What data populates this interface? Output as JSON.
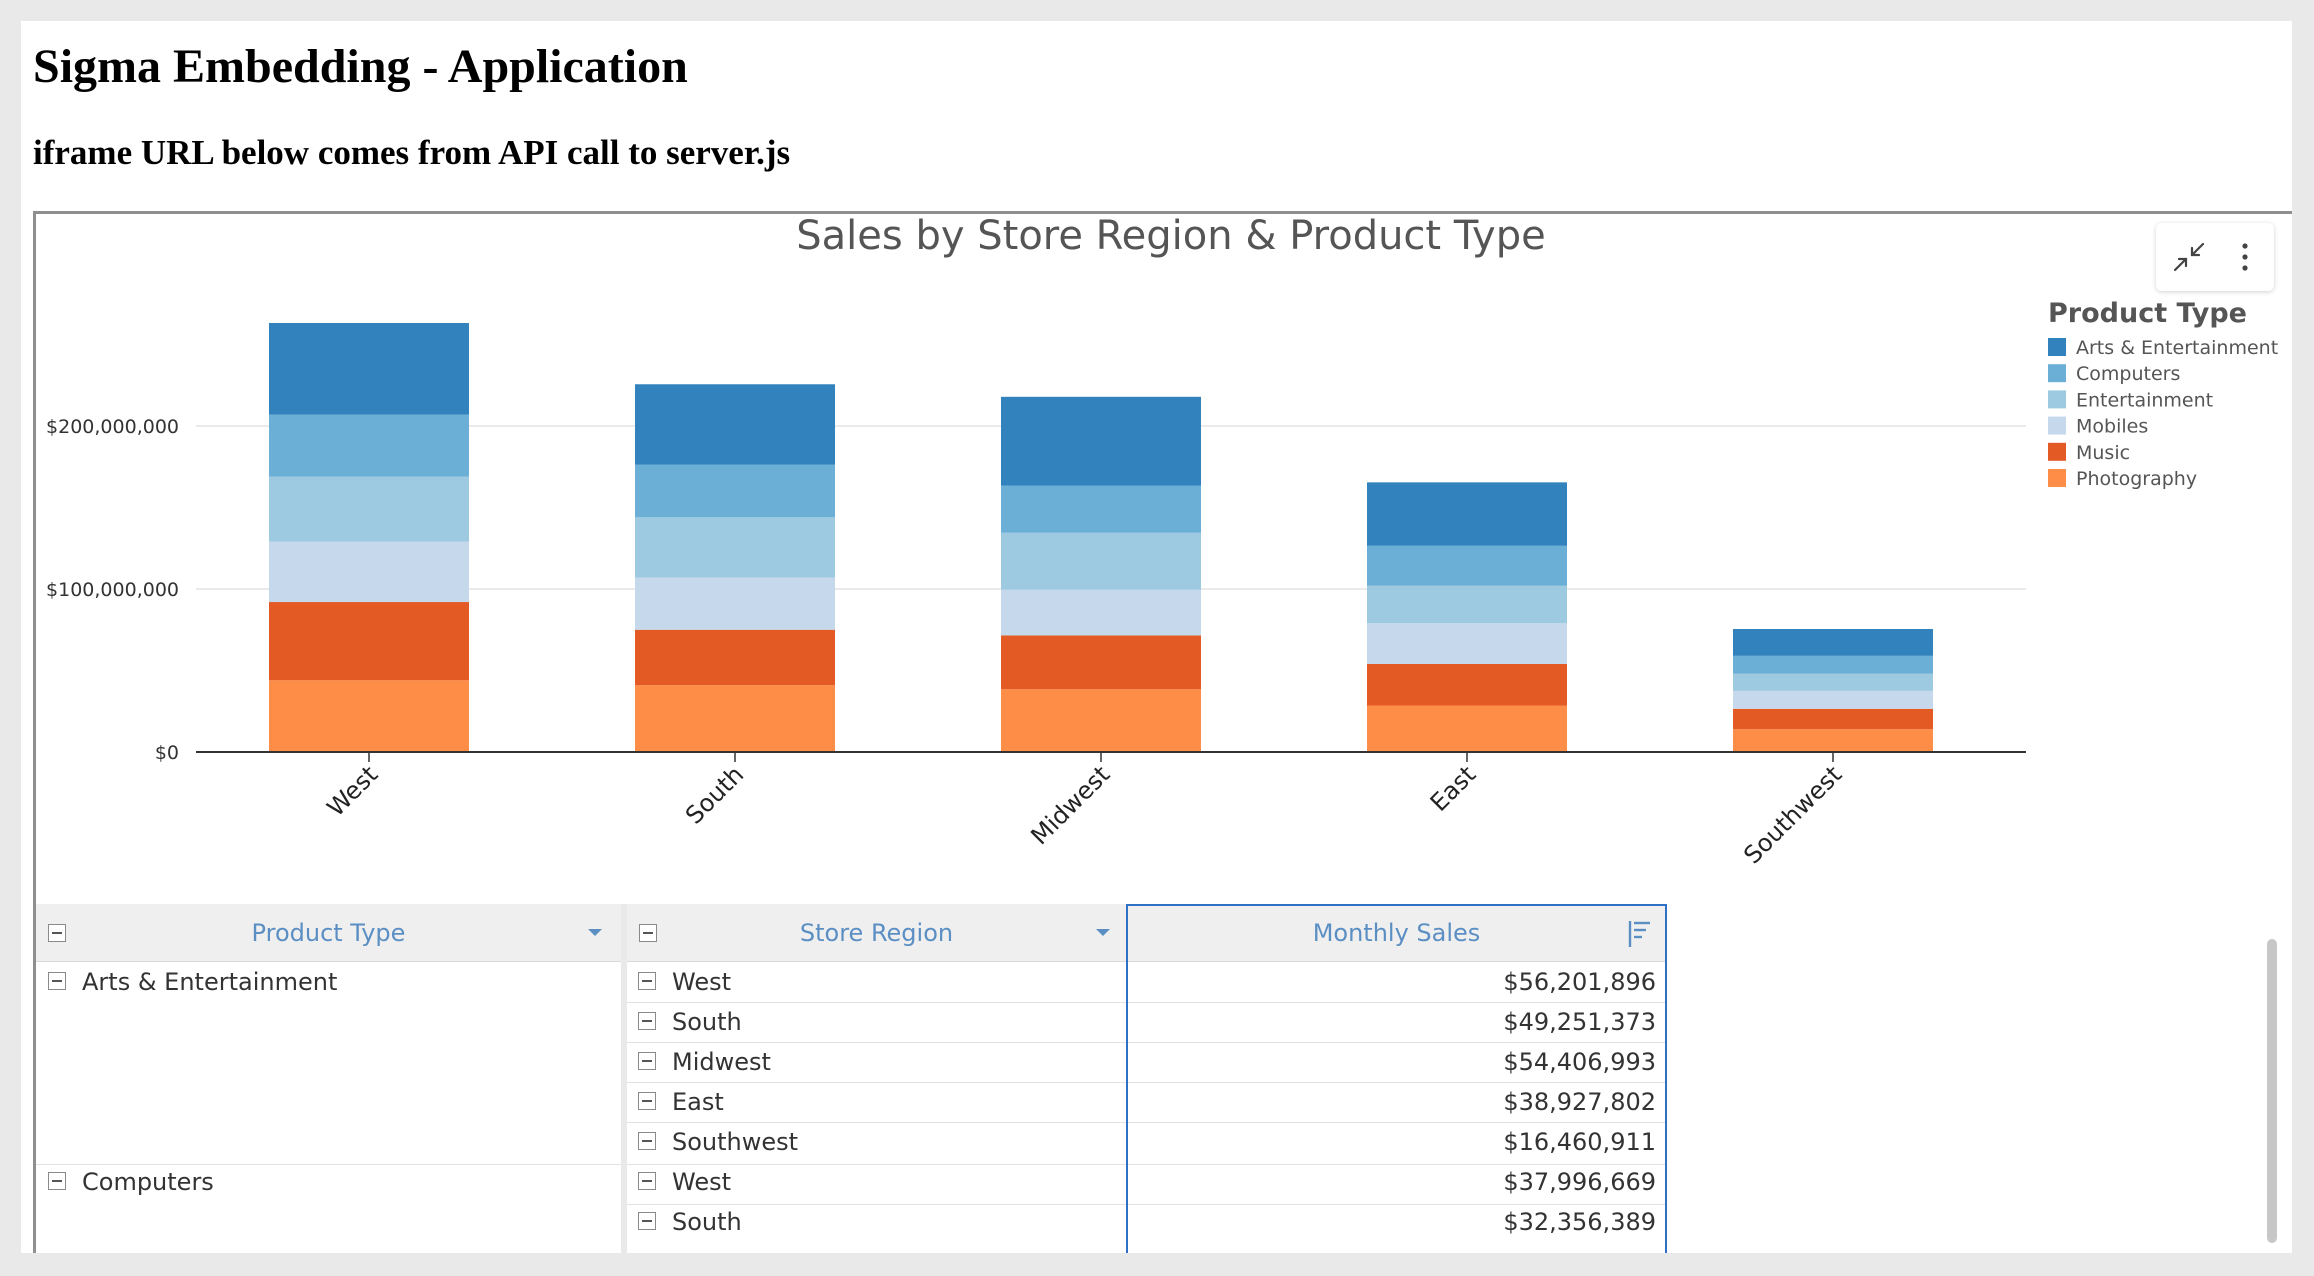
{
  "page": {
    "title": "Sigma Embedding - Application",
    "subtitle": "iframe URL below comes from API call to server.js"
  },
  "toolbar": {
    "collapse_icon": "collapse-arrows-icon",
    "more_icon": "vertical-ellipsis-icon"
  },
  "chart_data": {
    "type": "bar",
    "stacked": true,
    "title": "Sales by Store Region & Product Type",
    "xlabel": "",
    "ylabel": "",
    "categories": [
      "West",
      "South",
      "Midwest",
      "East",
      "Southwest"
    ],
    "ylim": [
      0,
      265000000
    ],
    "yticks": [
      0,
      100000000,
      200000000
    ],
    "ytick_labels": [
      "$0",
      "$100,000,000",
      "$200,000,000"
    ],
    "grid": true,
    "legend": {
      "title": "Product Type",
      "position": "right"
    },
    "series": [
      {
        "name": "Photography",
        "color": "#fd8d47",
        "values": [
          44000000,
          41000000,
          38500000,
          28500000,
          14000000
        ]
      },
      {
        "name": "Music",
        "color": "#e35a24",
        "values": [
          48000000,
          34000000,
          33000000,
          25500000,
          12500000
        ]
      },
      {
        "name": "Mobiles",
        "color": "#c6d9ec",
        "values": [
          37000000,
          32000000,
          28000000,
          25000000,
          11000000
        ]
      },
      {
        "name": "Entertainment",
        "color": "#9ecae1",
        "values": [
          40000000,
          37000000,
          35000000,
          23000000,
          10500000
        ]
      },
      {
        "name": "Computers",
        "color": "#6baed6",
        "values": [
          37996669,
          32356389,
          29000000,
          24500000,
          11000000
        ]
      },
      {
        "name": "Arts & Entertainment",
        "color": "#3182bd",
        "values": [
          56201896,
          49251373,
          54406993,
          38927802,
          16460911
        ]
      }
    ]
  },
  "table": {
    "headers": {
      "product_type": "Product Type",
      "store_region": "Store Region",
      "monthly_sales": "Monthly Sales"
    },
    "groups": [
      {
        "product_type": "Arts & Entertainment",
        "rows": [
          {
            "region": "West",
            "sales": "$56,201,896"
          },
          {
            "region": "South",
            "sales": "$49,251,373"
          },
          {
            "region": "Midwest",
            "sales": "$54,406,993"
          },
          {
            "region": "East",
            "sales": "$38,927,802"
          },
          {
            "region": "Southwest",
            "sales": "$16,460,911"
          }
        ]
      },
      {
        "product_type": "Computers",
        "rows": [
          {
            "region": "West",
            "sales": "$37,996,669"
          },
          {
            "region": "South",
            "sales": "$32,356,389"
          }
        ]
      }
    ]
  }
}
